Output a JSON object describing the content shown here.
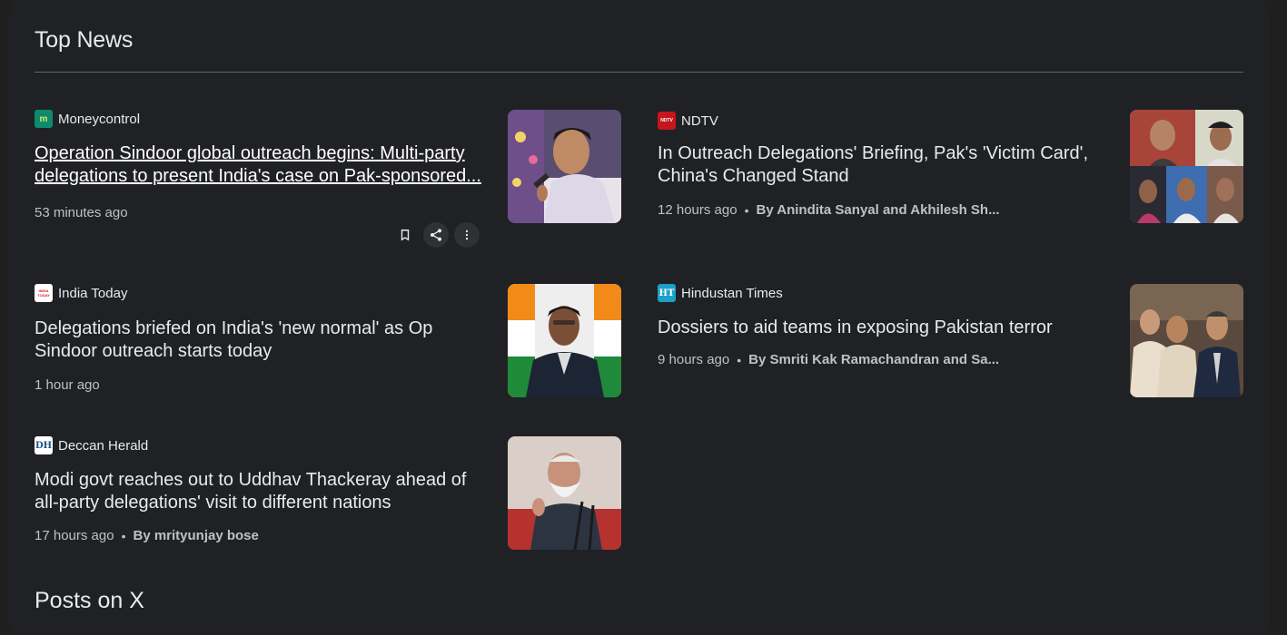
{
  "section": {
    "title": "Top News",
    "next_title": "Posts on X"
  },
  "articles": [
    {
      "source": "Moneycontrol",
      "favicon_text": "m",
      "headline": "Operation Sindoor global outreach begins: Multi-party delegations to present India's case on Pak-sponsored...",
      "time": "53 minutes ago",
      "author": ""
    },
    {
      "source": "NDTV",
      "favicon_text": "NDTV",
      "headline": "In Outreach Delegations' Briefing, Pak's 'Victim Card', China's Changed Stand",
      "time": "12 hours ago",
      "author": "By Anindita Sanyal and Akhilesh Sh..."
    },
    {
      "source": "India Today",
      "favicon_text": "INDIA TODAY",
      "headline": "Delegations briefed on India's 'new normal' as Op Sindoor outreach starts today",
      "time": "1 hour ago",
      "author": ""
    },
    {
      "source": "Hindustan Times",
      "favicon_text": "HT",
      "headline": "Dossiers to aid teams in exposing Pakistan terror",
      "time": "9 hours ago",
      "author": "By Smriti Kak Ramachandran and Sa..."
    },
    {
      "source": "Deccan Herald",
      "favicon_text": "DH",
      "headline": "Modi govt reaches out to Uddhav Thackeray ahead of all-party delegations' visit to different nations",
      "time": "17 hours ago",
      "author": "By mrityunjay bose"
    }
  ],
  "actions": {
    "bookmark": "bookmark-icon",
    "share": "share-icon",
    "more": "more-vert-icon"
  },
  "colors": {
    "background": "#1f1f1f",
    "panel": "#202124",
    "text": "#e8eaed",
    "secondary_text": "#bdc1c6",
    "divider": "#5f6368"
  }
}
